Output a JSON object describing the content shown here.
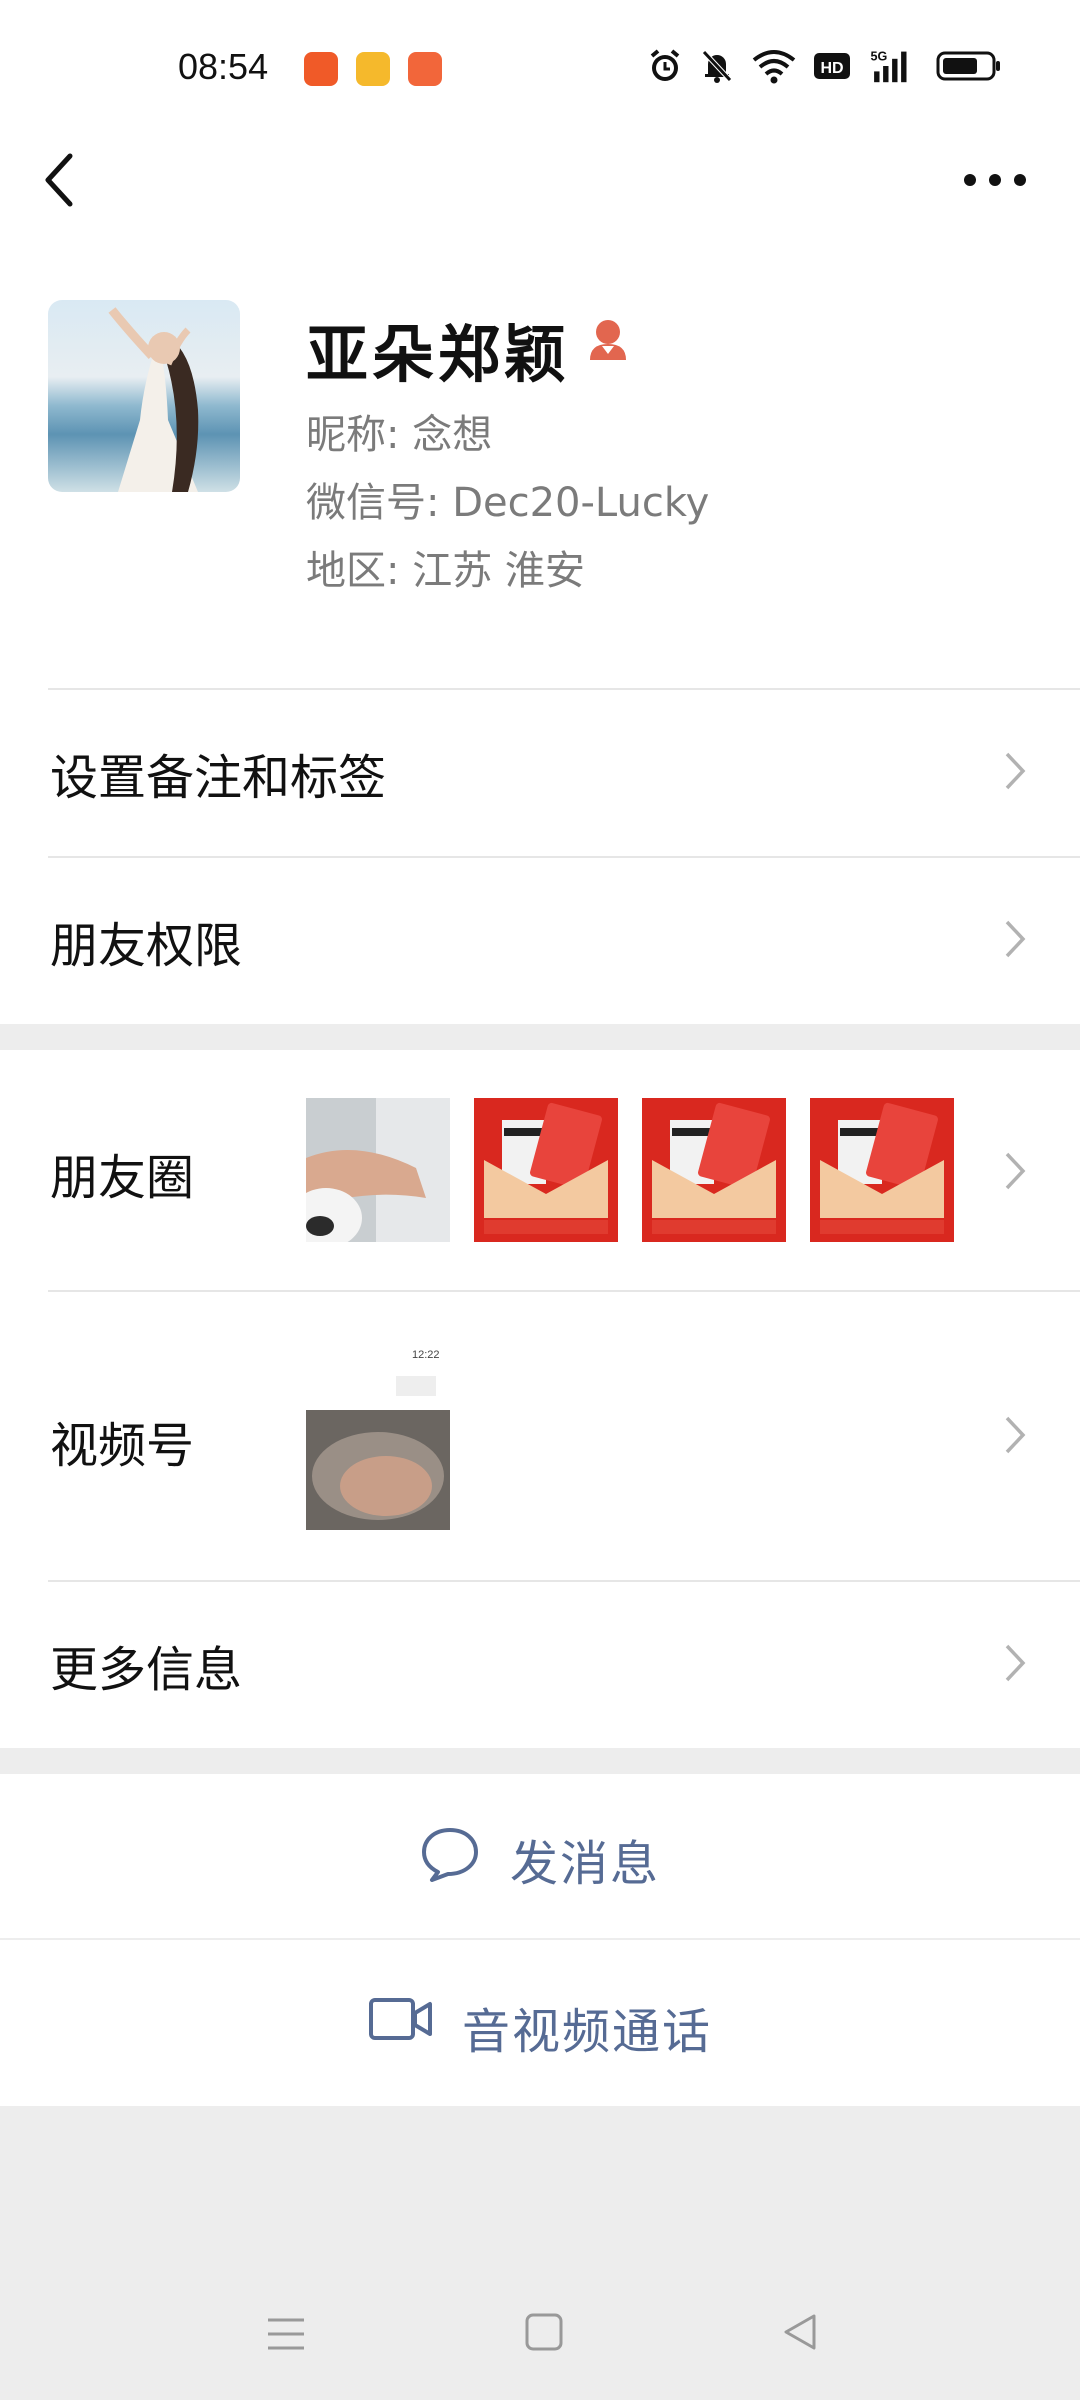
{
  "status_bar": {
    "time": "08:54",
    "app_icons": [
      "app-orange-icon",
      "app-yellow-book-icon",
      "app-orange-book-icon"
    ],
    "indicators": [
      "alarm-icon",
      "mute-bell-icon",
      "wifi-icon",
      "hd-icon",
      "signal-5g-icon",
      "battery-icon"
    ],
    "network": "5G",
    "hd": "HD"
  },
  "header": {
    "back_icon": "chevron-left-icon",
    "more_icon": "more-dots-icon"
  },
  "profile": {
    "name": "亚朵郑颖",
    "gender_icon": "female-icon",
    "nickname": "昵称:  念想",
    "wechat_id": "微信号:  Dec20-Lucky",
    "region": "地区:  江苏  淮安"
  },
  "menu": {
    "remark_tags": "设置备注和标签",
    "friend_permissions": "朋友权限",
    "moments": "朋友圈",
    "channels": "视频号",
    "more_info": "更多信息"
  },
  "channels_thumb": {
    "time": "12:22"
  },
  "actions": {
    "send_message": "发消息",
    "video_call": "音视频通话"
  },
  "colors": {
    "action_text": "#566b94",
    "background": "#ededed",
    "red_packet": "#d9281f",
    "gender_icon": "#e2664f"
  }
}
